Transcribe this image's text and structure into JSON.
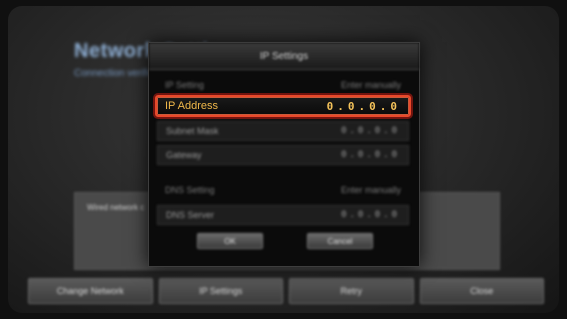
{
  "background": {
    "title": "Network Settings",
    "subtitle": "Connection verified",
    "panel_text": "Wired network c",
    "buttons": [
      "Change Network",
      "IP Settings",
      "Retry",
      "Close"
    ]
  },
  "dialog": {
    "title": "IP Settings",
    "ip_setting": {
      "label": "IP Setting",
      "value": "Enter manually"
    },
    "ip_address": {
      "label": "IP Address",
      "value": "0.0.0.0"
    },
    "subnet_mask": {
      "label": "Subnet Mask",
      "value": "0.0.0.0"
    },
    "gateway": {
      "label": "Gateway",
      "value": "0.0.0.0"
    },
    "dns_setting": {
      "label": "DNS Setting",
      "value": "Enter manually"
    },
    "dns_server": {
      "label": "DNS Server",
      "value": "0.0.0.0"
    },
    "ok_label": "OK",
    "cancel_label": "Cancel"
  },
  "colors": {
    "focus_border": "#e8482a",
    "focus_text": "#f0b84a"
  }
}
